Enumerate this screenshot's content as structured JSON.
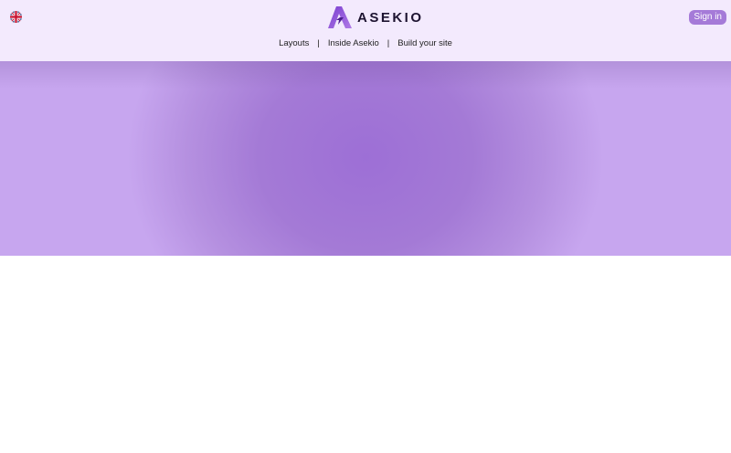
{
  "header": {
    "language": {
      "icon": "uk-flag-icon",
      "label": ""
    },
    "logo": {
      "icon": "asekio-logo-icon",
      "text": "ASEKIO"
    },
    "signin_label": "Sign in",
    "nav": [
      {
        "label": "Layouts"
      },
      {
        "label": "Inside Asekio"
      },
      {
        "label": "Build your site"
      }
    ],
    "separator": "|"
  },
  "colors": {
    "header_bg": "#f3eafd",
    "accent": "#a57ad8",
    "hero_center": "#9d6fd6",
    "hero_edge": "#c7a6ef"
  }
}
